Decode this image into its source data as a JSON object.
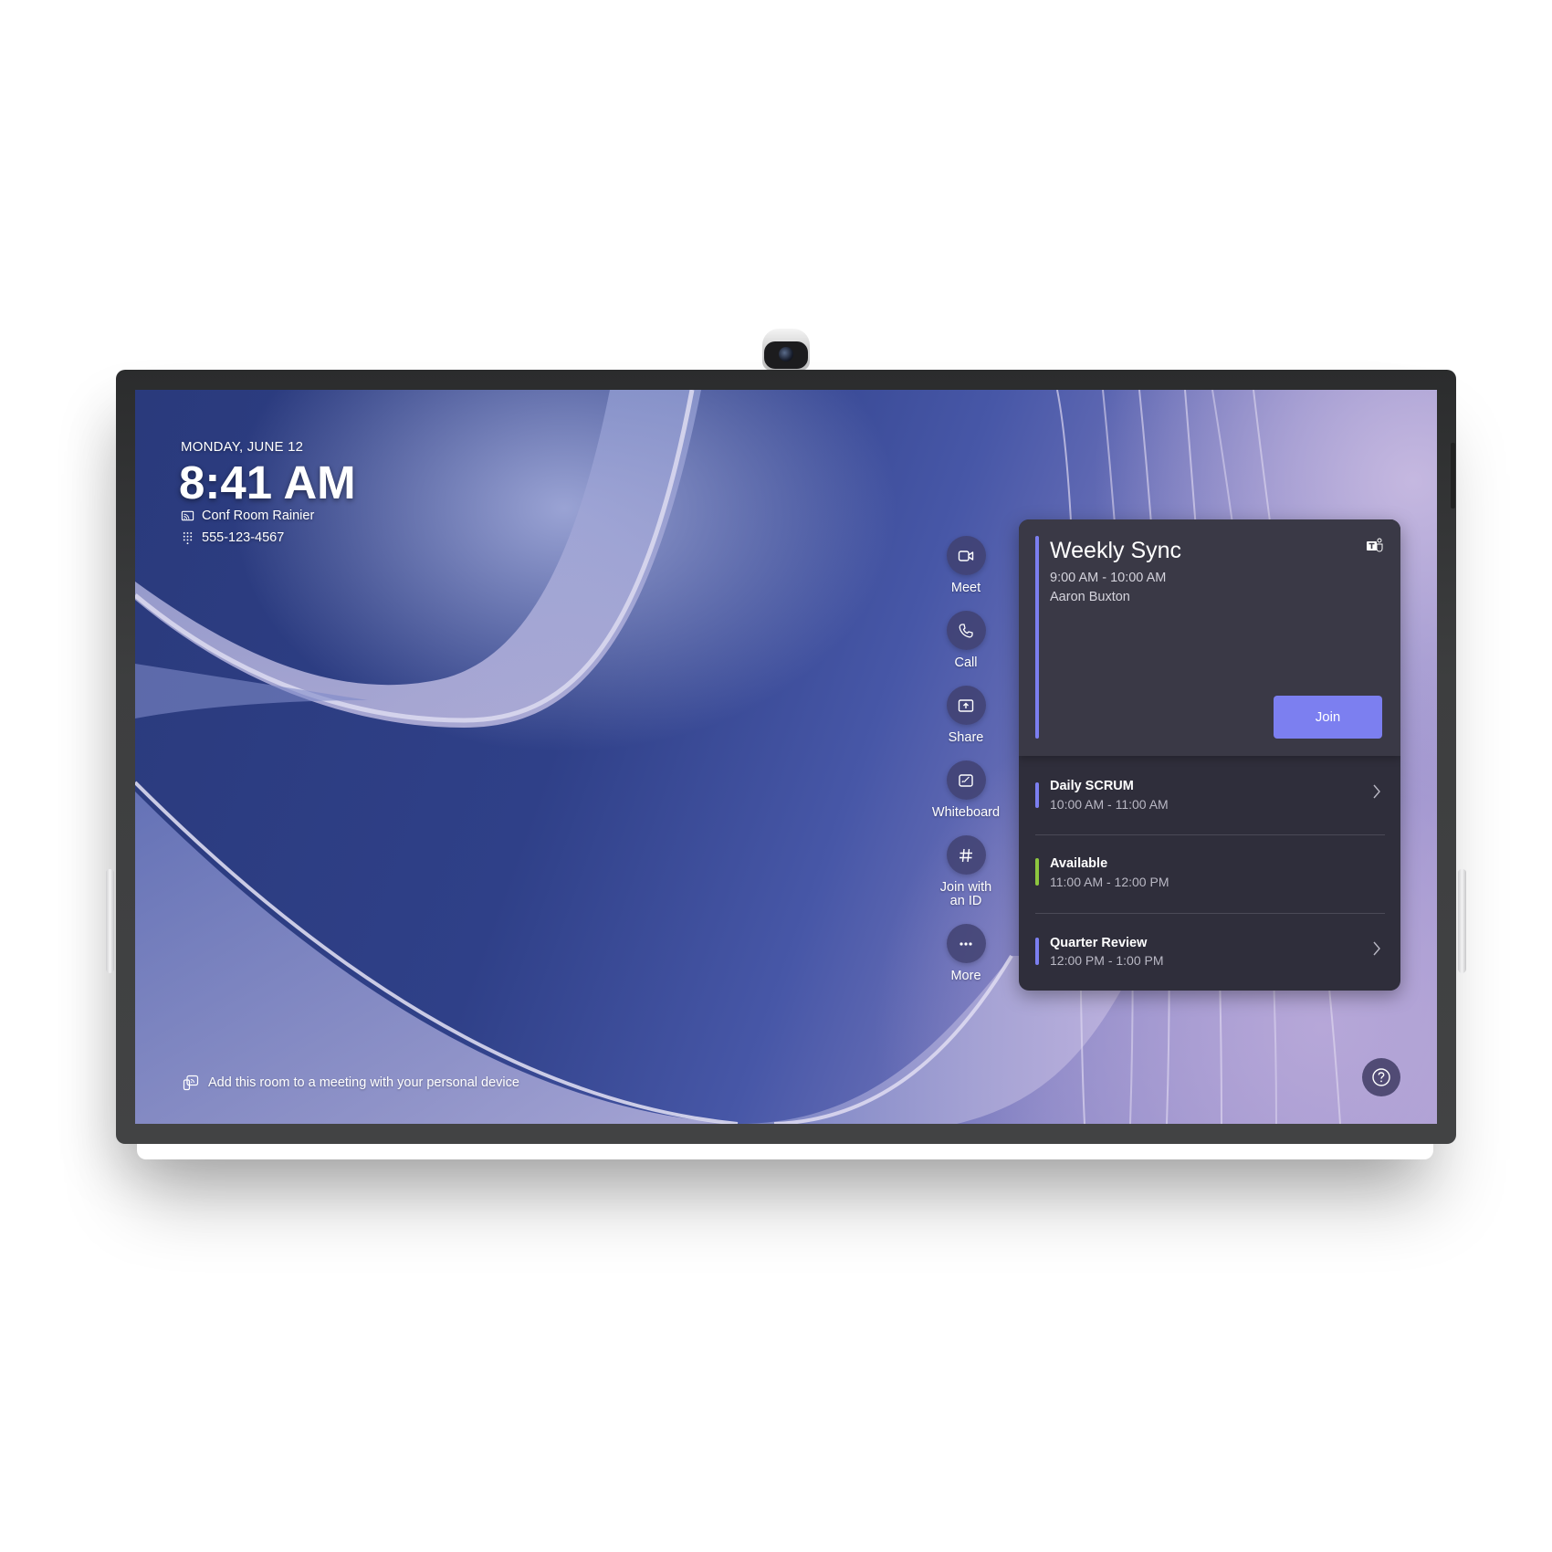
{
  "device": {
    "hardware": "touch-display-with-camera"
  },
  "home": {
    "date": "MONDAY, JUNE 12",
    "time": "8:41 AM",
    "room_name": "Conf Room Rainier",
    "room_icon": "cast-icon",
    "phone_number": "555-123-4567",
    "phone_icon": "dialpad-icon"
  },
  "actions": [
    {
      "label": "Meet",
      "icon": "video-camera-icon"
    },
    {
      "label": "Call",
      "icon": "phone-icon"
    },
    {
      "label": "Share",
      "icon": "share-screen-icon"
    },
    {
      "label": "Whiteboard",
      "icon": "whiteboard-icon"
    },
    {
      "label": "Join with an ID",
      "label_line1": "Join with",
      "label_line2": "an ID",
      "icon": "hash-icon"
    },
    {
      "label": "More",
      "icon": "more-icon"
    }
  ],
  "calendar": {
    "current": {
      "title": "Weekly Sync",
      "time": "9:00 AM - 10:00 AM",
      "organizer": "Aaron Buxton",
      "join_label": "Join",
      "app_icon": "teams-icon",
      "accent": "#7c7ff0"
    },
    "upcoming": [
      {
        "title": "Daily SCRUM",
        "time": "10:00 AM - 11:00 AM",
        "accent": "#7c7ff0",
        "has_chevron": true
      },
      {
        "title": "Available",
        "time": "11:00 AM - 12:00 PM",
        "accent": "#8dc63f",
        "has_chevron": false
      },
      {
        "title": "Quarter Review",
        "time": "12:00 PM - 1:00 PM",
        "accent": "#7c7ff0",
        "has_chevron": true
      }
    ]
  },
  "footer": {
    "hint": "Add this room to a meeting with your personal device",
    "hint_icon": "proximity-join-icon",
    "help_icon": "help-icon"
  },
  "colors": {
    "join_button": "#7c7ff0",
    "card_background": "#2f2e3b",
    "available_accent": "#8dc63f"
  }
}
